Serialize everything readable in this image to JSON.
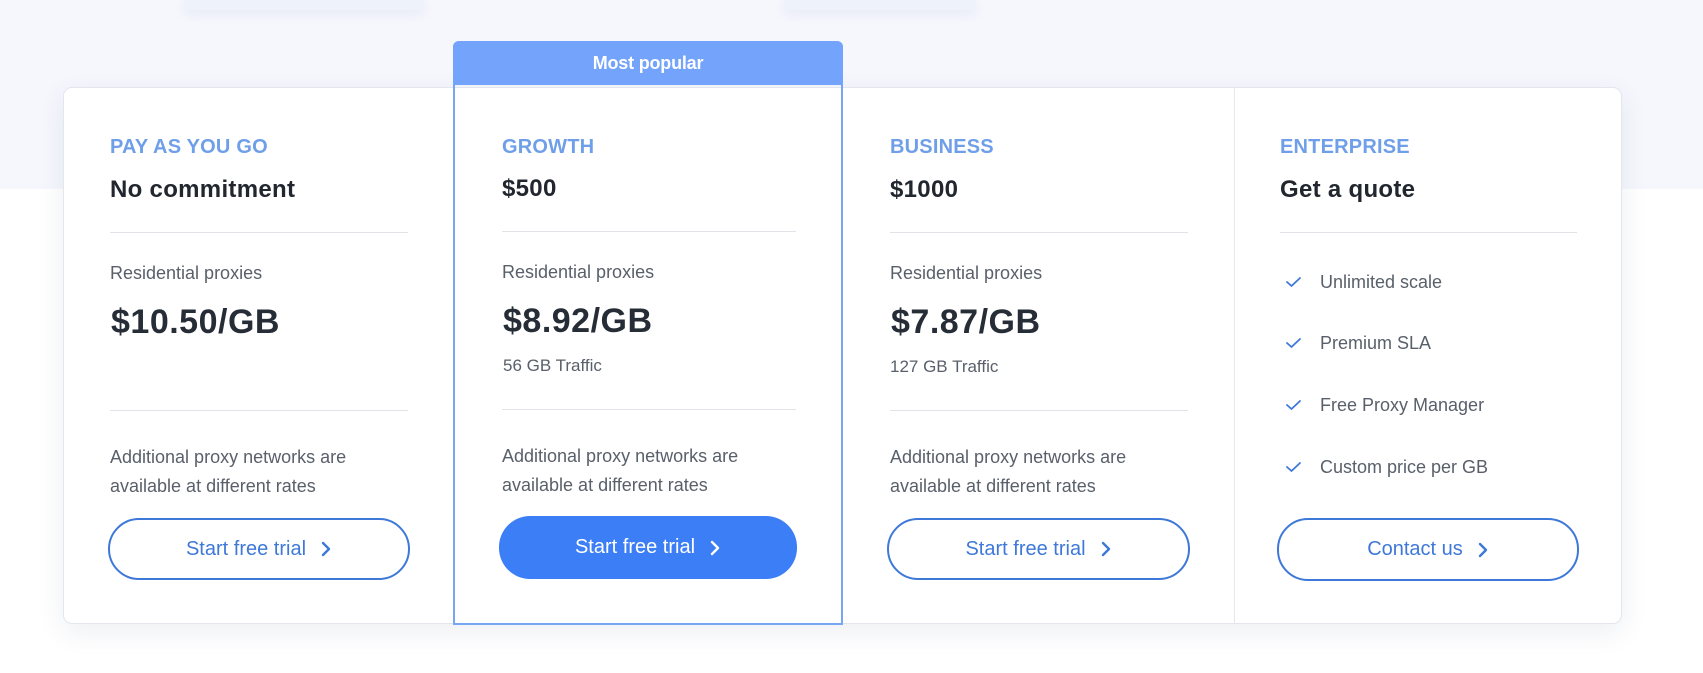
{
  "badge": {
    "label": "Most popular"
  },
  "plans": [
    {
      "name": "PAY AS YOU GO",
      "subtitle": "No commitment",
      "product": "Residential proxies",
      "price": "$10.50/GB",
      "traffic": "",
      "note": "Additional proxy networks are available at different rates",
      "cta": "Start free trial"
    },
    {
      "name": "GROWTH",
      "subtitle": "$500",
      "product": "Residential proxies",
      "price": "$8.92/GB",
      "traffic": "56 GB Traffic",
      "note": "Additional proxy networks are available at different rates",
      "cta": "Start free trial",
      "highlighted": true
    },
    {
      "name": "BUSINESS",
      "subtitle": "$1000",
      "product": "Residential proxies",
      "price": "$7.87/GB",
      "traffic": "127 GB Traffic",
      "note": "Additional proxy networks are available at different rates",
      "cta": "Start free trial"
    },
    {
      "name": "ENTERPRISE",
      "subtitle": "Get a quote",
      "features": [
        {
          "icon": "check-icon",
          "label": "Unlimited scale"
        },
        {
          "icon": "check-icon",
          "label": "Premium SLA"
        },
        {
          "icon": "check-icon",
          "label": "Free Proxy Manager"
        },
        {
          "icon": "check-icon",
          "label": "Custom price per GB"
        }
      ],
      "cta": "Contact us"
    }
  ],
  "colors": {
    "accent": "#3c7ef5",
    "badge": "#73a3fa",
    "plan_name": "#6f9fe8",
    "text_dark": "#262d37",
    "text_muted": "#59606b"
  }
}
